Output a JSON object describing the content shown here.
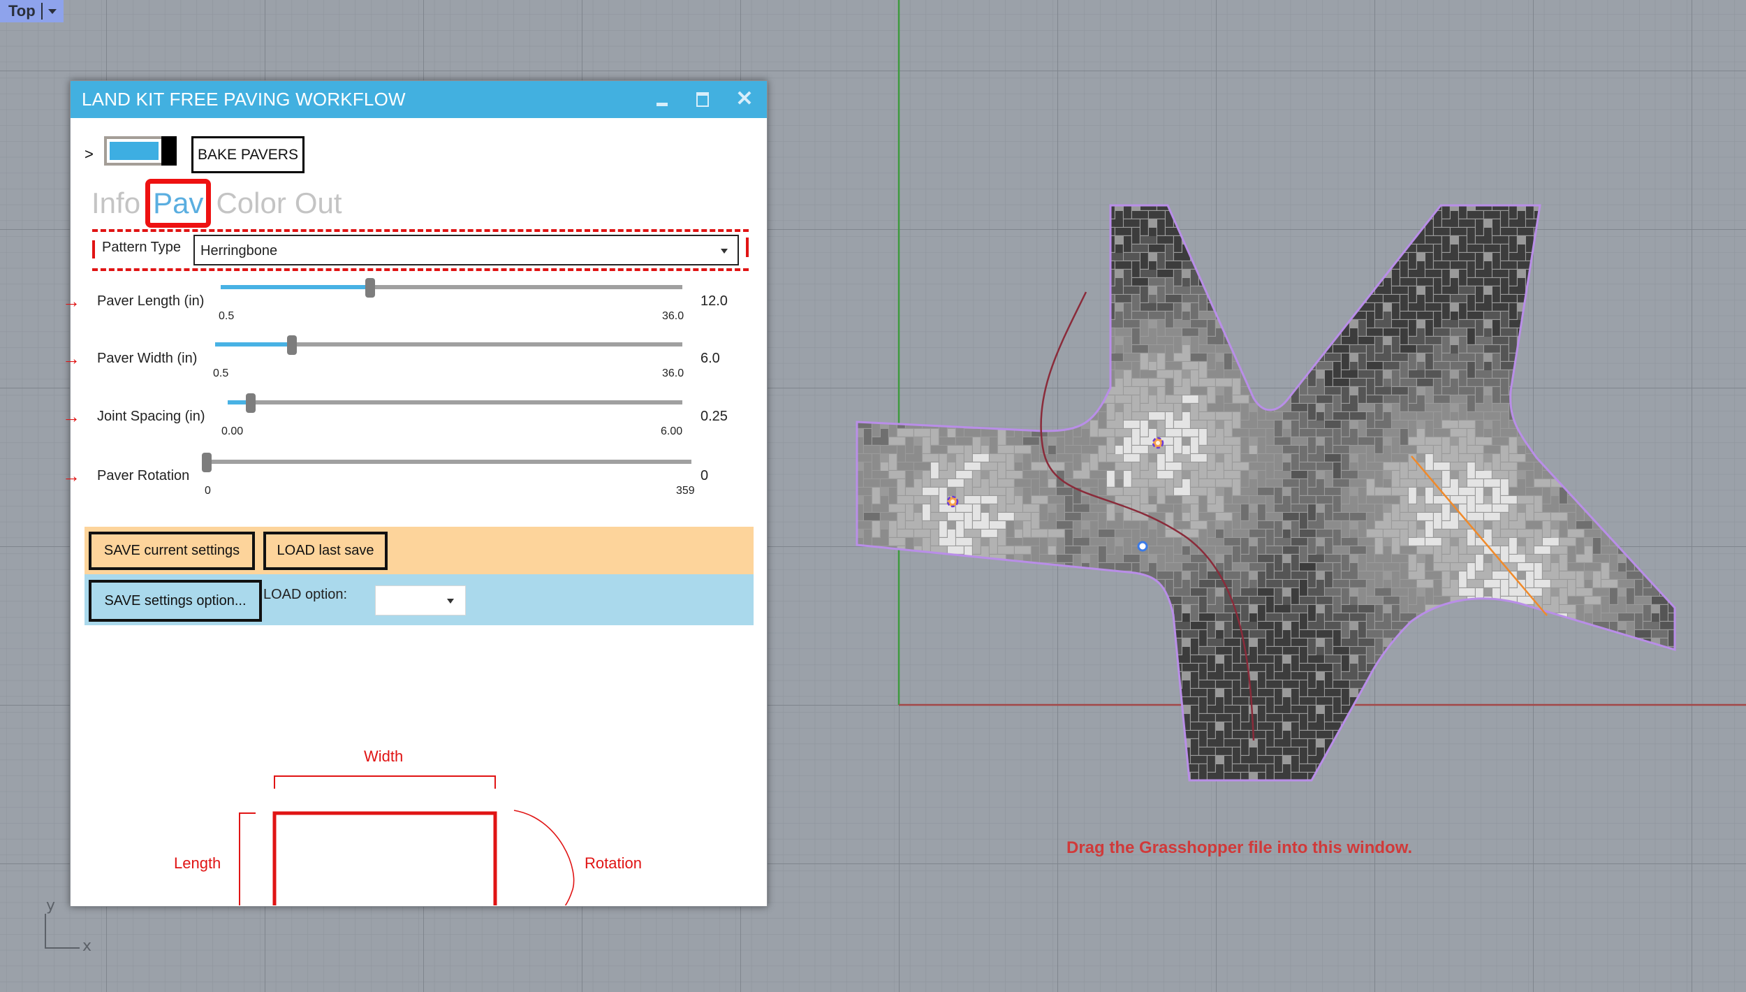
{
  "viewport": {
    "name": "Top",
    "message": "Drag the Grasshopper file into this window.",
    "axis_labels": {
      "x": "x",
      "y": "y"
    },
    "colors": {
      "background": "#9ba1a9",
      "grid_minor": "#8f959d",
      "grid_major": "#7f858d",
      "x_axis": "#a34848",
      "y_axis": "#3e9a3e",
      "boundary": "#b98ee8",
      "curve": "#8a2b3a",
      "guide_line": "#f08a2a",
      "message": "#d03a3a"
    },
    "paver_shades": [
      "#3c3c3c",
      "#555555",
      "#6f6f6f",
      "#8c8c8c",
      "#b2b2b2",
      "#e4e4e4"
    ]
  },
  "dialog": {
    "title": "LAND KIT FREE PAVING WORKFLOW",
    "window_buttons": {
      "minimize": "minimize",
      "maximize": "maximize",
      "close": "close"
    },
    "expander": ">",
    "toggle_state": "on",
    "bake_label": "BAKE PAVERS",
    "tabs": [
      {
        "label": "Info",
        "active": false
      },
      {
        "label": "Pav",
        "active": true
      },
      {
        "label": "Color",
        "active": false
      },
      {
        "label": "Out",
        "active": false
      }
    ],
    "pattern": {
      "label": "Pattern Type",
      "value": "Herringbone"
    },
    "sliders": [
      {
        "label": "Paver Length (in)",
        "min": "0.5",
        "max": "36.0",
        "value": "12.0",
        "fraction": 0.324
      },
      {
        "label": "Paver Width (in)",
        "min": "0.5",
        "max": "36.0",
        "value": "6.0",
        "fraction": 0.164
      },
      {
        "label": "Joint Spacing (in)",
        "min": "0.00",
        "max": "6.00",
        "value": "0.25",
        "fraction": 0.05
      },
      {
        "label": "Paver Rotation",
        "min": "0",
        "max": "359",
        "value": "0",
        "fraction": 0.0
      }
    ],
    "save_current_label": "SAVE current settings",
    "load_last_label": "LOAD last save",
    "save_option_label": "SAVE settings option...",
    "load_option_label": "LOAD option:",
    "load_option_value": "",
    "diagram": {
      "width": "Width",
      "length": "Length",
      "rotation": "Rotation"
    },
    "colors": {
      "titlebar": "#42b0e0",
      "accent_red": "#e01414",
      "tab_active": "#5aaee0",
      "tab_inactive": "#c4c4c4",
      "slider_fill": "#48b2e4",
      "band_orange": "#fdd49b",
      "band_blue": "#aad9ec"
    }
  }
}
